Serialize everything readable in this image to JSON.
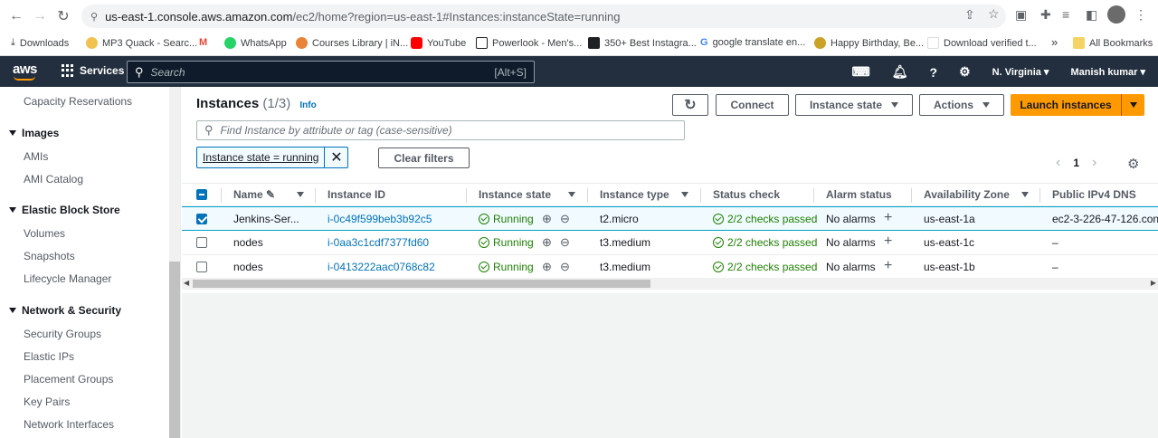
{
  "browser": {
    "url_host": "us-east-1.console.aws.amazon.com",
    "url_path": "/ec2/home?region=us-east-1#Instances:instanceState=running",
    "bookmarks": [
      "Downloads",
      "MP3 Quack - Searc...",
      "WhatsApp",
      "Courses Library | iN...",
      "YouTube",
      "Powerlook - Men's...",
      "350+ Best Instagra...",
      "google translate en...",
      "Happy Birthday, Be...",
      "Download verified t..."
    ],
    "bookmarks_overflow": "»",
    "all_bookmarks": "All Bookmarks"
  },
  "aws": {
    "logo": "aws",
    "services": "Services",
    "search_placeholder": "Search",
    "search_shortcut": "[Alt+S]",
    "region": "N. Virginia",
    "user": "Manish kumar"
  },
  "sidebar": {
    "items": [
      {
        "label": "Capacity Reservations"
      },
      {
        "section": "Images"
      },
      {
        "label": "AMIs"
      },
      {
        "label": "AMI Catalog"
      },
      {
        "section": "Elastic Block Store"
      },
      {
        "label": "Volumes"
      },
      {
        "label": "Snapshots"
      },
      {
        "label": "Lifecycle Manager"
      },
      {
        "section": "Network & Security"
      },
      {
        "label": "Security Groups"
      },
      {
        "label": "Elastic IPs"
      },
      {
        "label": "Placement Groups"
      },
      {
        "label": "Key Pairs"
      },
      {
        "label": "Network Interfaces"
      }
    ]
  },
  "main": {
    "title": "Instances",
    "count": "(1/3)",
    "info": "Info",
    "buttons": {
      "refresh": "↻",
      "connect": "Connect",
      "instance_state": "Instance state",
      "actions": "Actions",
      "launch": "Launch instances"
    },
    "filter_placeholder": "Find Instance by attribute or tag (case-sensitive)",
    "token": "Instance state = running",
    "clear_filters": "Clear filters",
    "page": "1",
    "columns": [
      "Name",
      "Instance ID",
      "Instance state",
      "Instance type",
      "Status check",
      "Alarm status",
      "Availability Zone",
      "Public IPv4 DNS"
    ],
    "rows": [
      {
        "selected": true,
        "name": "Jenkins-Ser...",
        "id": "i-0c49f599beb3b92c5",
        "state": "Running",
        "type": "t2.micro",
        "status": "2/2 checks passed",
        "alarm": "No alarms",
        "az": "us-east-1a",
        "dns": "ec2-3-226-47-126.con"
      },
      {
        "selected": false,
        "name": "nodes",
        "id": "i-0aa3c1cdf7377fd60",
        "state": "Running",
        "type": "t3.medium",
        "status": "2/2 checks passed",
        "alarm": "No alarms",
        "az": "us-east-1c",
        "dns": "–"
      },
      {
        "selected": false,
        "name": "nodes",
        "id": "i-0413222aac0768c82",
        "state": "Running",
        "type": "t3.medium",
        "status": "2/2 checks passed",
        "alarm": "No alarms",
        "az": "us-east-1b",
        "dns": "–"
      }
    ]
  }
}
